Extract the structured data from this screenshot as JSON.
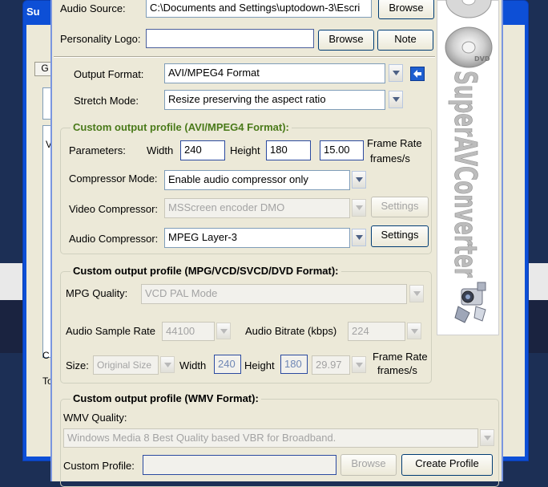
{
  "back_window": {
    "title": "Su",
    "tab_label": "G",
    "list_label": "V",
    "label_c": "C",
    "label_t": "To"
  },
  "audio_source": {
    "label": "Audio Source:",
    "value": "C:\\Documents and Settings\\uptodown-3\\Escri",
    "browse_label": "Browse"
  },
  "personality_logo": {
    "label": "Personality Logo:",
    "value": "",
    "browse_label": "Browse",
    "note_label": "Note"
  },
  "output_format": {
    "label": "Output Format:",
    "value": "AVI/MPEG4 Format"
  },
  "stretch_mode": {
    "label": "Stretch Mode:",
    "value": "Resize preserving the aspect ratio"
  },
  "avi_profile": {
    "title": "Custom output profile (AVI/MPEG4 Format):",
    "parameters_label": "Parameters:",
    "width_label": "Width",
    "width_value": "240",
    "height_label": "Height",
    "height_value": "180",
    "frame_rate_value": "15.00",
    "frame_rate_label_1": "Frame Rate",
    "frame_rate_label_2": "frames/s",
    "compressor_mode_label": "Compressor Mode:",
    "compressor_mode_value": "Enable audio compressor only",
    "video_compressor_label": "Video Compressor:",
    "video_compressor_value": "MSScreen encoder DMO",
    "video_settings_label": "Settings",
    "audio_compressor_label": "Audio Compressor:",
    "audio_compressor_value": "MPEG Layer-3",
    "audio_settings_label": "Settings"
  },
  "mpg_profile": {
    "title": "Custom output profile (MPG/VCD/SVCD/DVD Format):",
    "quality_label": "MPG Quality:",
    "quality_value": "VCD PAL Mode",
    "sample_rate_label": "Audio Sample Rate",
    "sample_rate_value": "44100",
    "bitrate_label": "Audio Bitrate (kbps)",
    "bitrate_value": "224",
    "size_label": "Size:",
    "size_value": "Original Size",
    "width_label": "Width",
    "width_value": "240",
    "height_label": "Height",
    "height_value": "180",
    "frame_rate_value": "29.97",
    "frame_rate_label_1": "Frame Rate",
    "frame_rate_label_2": "frames/s"
  },
  "wmv_profile": {
    "title": "Custom output profile (WMV Format):",
    "quality_label": "WMV Quality:",
    "quality_value": "Windows Media 8 Best Quality based VBR for Broadband.",
    "custom_profile_label": "Custom Profile:",
    "custom_profile_value": "",
    "browse_label": "Browse",
    "create_label": "Create Profile"
  },
  "brand": {
    "name": "SuperAVConverter",
    "disc_label": "DVD"
  },
  "colors": {
    "group_title_green": "#4a7a1a",
    "xp_blue": "#0d4fd6",
    "field_border": "#7f9db9"
  },
  "icons": [
    "arrow-left-icon",
    "dropdown-arrow-icon",
    "dvd-disc-icon",
    "camcorder-icon"
  ]
}
